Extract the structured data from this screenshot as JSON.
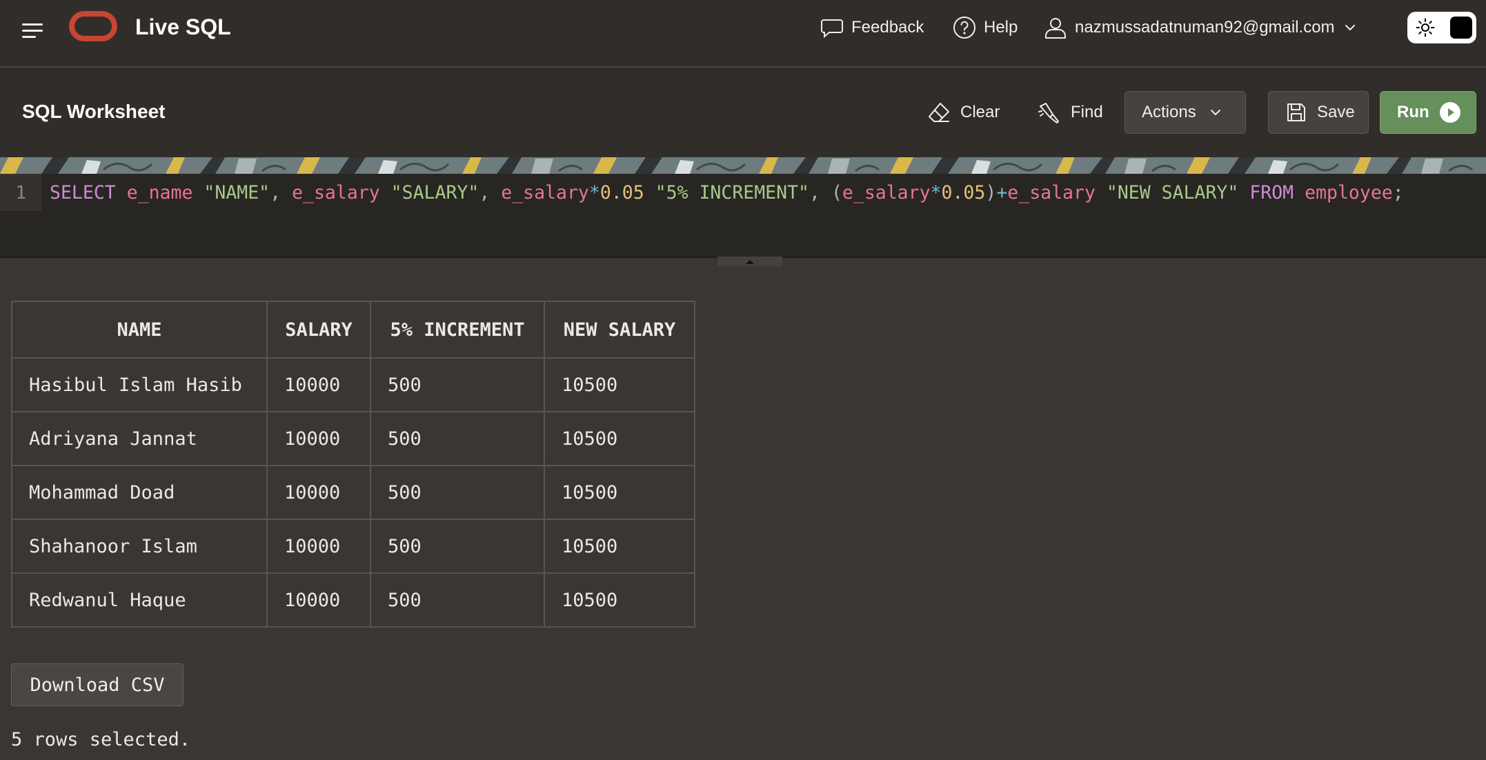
{
  "header": {
    "app_title": "Live SQL",
    "menu_icon": "hamburger-menu-icon",
    "logo": "oracle-logo",
    "feedback_label": "Feedback",
    "help_label": "Help",
    "user_email": "nazmussadatnuman92@gmail.com",
    "theme_mode": "dark"
  },
  "toolbar": {
    "title": "SQL Worksheet",
    "clear_label": "Clear",
    "find_label": "Find",
    "actions_label": "Actions",
    "save_label": "Save",
    "run_label": "Run"
  },
  "editor": {
    "line_number": "1",
    "tokens": [
      {
        "t": "SELECT",
        "c": "kw"
      },
      {
        "t": " ",
        "c": ""
      },
      {
        "t": "e_name",
        "c": "id"
      },
      {
        "t": " ",
        "c": ""
      },
      {
        "t": "\"NAME\"",
        "c": "str"
      },
      {
        "t": ", ",
        "c": "punc"
      },
      {
        "t": "e_salary",
        "c": "id"
      },
      {
        "t": " ",
        "c": ""
      },
      {
        "t": "\"SALARY\"",
        "c": "str"
      },
      {
        "t": ", ",
        "c": "punc"
      },
      {
        "t": "e_salary",
        "c": "id"
      },
      {
        "t": "*",
        "c": "op"
      },
      {
        "t": "0.05",
        "c": "num"
      },
      {
        "t": " ",
        "c": ""
      },
      {
        "t": "\"5% INCREMENT\"",
        "c": "str"
      },
      {
        "t": ", ",
        "c": "punc"
      },
      {
        "t": "(",
        "c": "punc"
      },
      {
        "t": "e_salary",
        "c": "id"
      },
      {
        "t": "*",
        "c": "op"
      },
      {
        "t": "0.05",
        "c": "num"
      },
      {
        "t": ")",
        "c": "punc"
      },
      {
        "t": "+",
        "c": "op"
      },
      {
        "t": "e_salary",
        "c": "id"
      },
      {
        "t": " ",
        "c": ""
      },
      {
        "t": "\"NEW SALARY\"",
        "c": "str"
      },
      {
        "t": " ",
        "c": ""
      },
      {
        "t": "FROM",
        "c": "kw"
      },
      {
        "t": " ",
        "c": ""
      },
      {
        "t": "employee",
        "c": "id"
      },
      {
        "t": ";",
        "c": "punc"
      }
    ]
  },
  "results": {
    "columns": [
      "NAME",
      "SALARY",
      "5% INCREMENT",
      "NEW SALARY"
    ],
    "rows": [
      [
        "Hasibul Islam Hasib",
        "10000",
        "500",
        "10500"
      ],
      [
        "Adriyana Jannat",
        "10000",
        "500",
        "10500"
      ],
      [
        "Mohammad Doad",
        "10000",
        "500",
        "10500"
      ],
      [
        "Shahanoor Islam",
        "10000",
        "500",
        "10500"
      ],
      [
        "Redwanul Haque",
        "10000",
        "500",
        "10500"
      ]
    ],
    "download_label": "Download CSV",
    "status_text": "5 rows selected."
  },
  "colors": {
    "run_button": "#658f5b",
    "logo": "#c74634",
    "background": "#3a3631",
    "header": "#312d2a"
  }
}
